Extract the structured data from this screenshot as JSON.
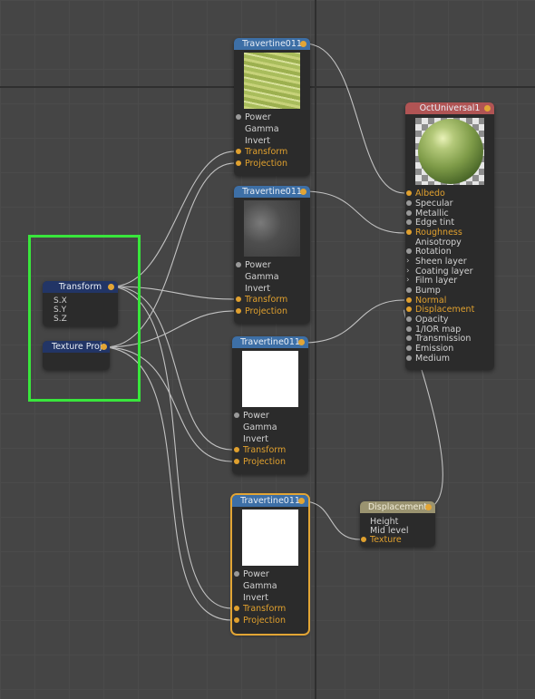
{
  "app": "Octane node graph editor",
  "nodes": {
    "trav1": {
      "title": "Travertine011",
      "pins": [
        "Power",
        "Gamma",
        "Invert",
        "Transform",
        "Projection"
      ],
      "active_pins": [
        3,
        4
      ]
    },
    "trav2": {
      "title": "Travertine011",
      "pins": [
        "Power",
        "Gamma",
        "Invert",
        "Transform",
        "Projection"
      ],
      "active_pins": [
        3,
        4
      ]
    },
    "trav3": {
      "title": "Travertine011",
      "pins": [
        "Power",
        "Gamma",
        "Invert",
        "Transform",
        "Projection"
      ],
      "active_pins": [
        3,
        4
      ]
    },
    "trav4": {
      "title": "Travertine011",
      "pins": [
        "Power",
        "Gamma",
        "Invert",
        "Transform",
        "Projection"
      ],
      "active_pins": [
        3,
        4
      ],
      "selected": true
    },
    "material": {
      "title": "OctUniversal1",
      "pins": [
        "Albedo",
        "Specular",
        "Metallic",
        "Edge tint",
        "Roughness",
        "Anisotropy",
        "Rotation",
        "Sheen layer",
        "Coating layer",
        "Film layer",
        "Bump",
        "Normal",
        "Displacement",
        "Opacity",
        "1/IOR map",
        "Transmission",
        "Emission",
        "Medium"
      ],
      "active_pins": [
        0,
        4,
        11,
        12
      ],
      "expandable_pins": [
        7,
        8,
        9
      ]
    },
    "displacement": {
      "title": "Displacement",
      "pins": [
        "Height",
        "Mid level",
        "Texture"
      ],
      "active_pins": [
        2
      ]
    },
    "transform": {
      "title": "Transform",
      "params": [
        "S.X",
        "S.Y",
        "S.Z"
      ]
    },
    "projection": {
      "title": "Texture Proj"
    }
  },
  "colors": {
    "texture_header": "#3d6fa6",
    "material_header": "#b05454",
    "displacement_header": "#9a9370",
    "util_header": "#223566",
    "active_pin": "#e0a02e",
    "selection_highlight": "#39e63c"
  }
}
